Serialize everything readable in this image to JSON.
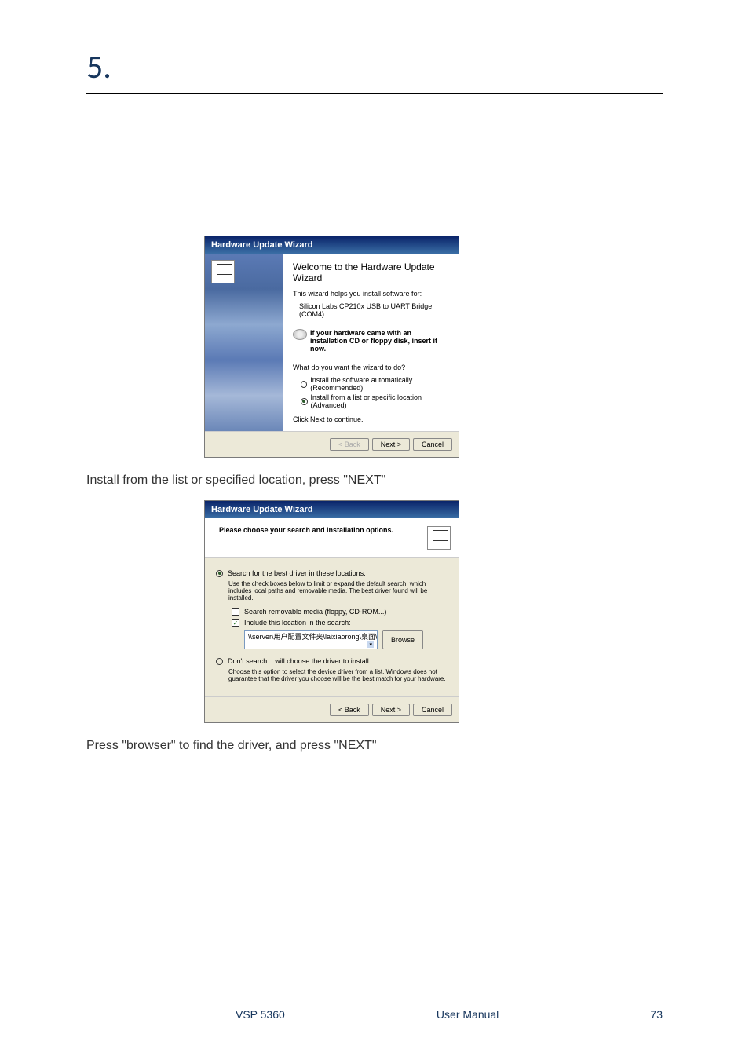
{
  "section_number": "5.",
  "wizard1": {
    "titlebar": "Hardware Update Wizard",
    "heading": "Welcome to the Hardware Update Wizard",
    "helps_line": "This wizard helps you install software for:",
    "device": "Silicon Labs CP210x USB to UART Bridge (COM4)",
    "cd_bold": "If your hardware came with an installation CD or floppy disk, insert it now.",
    "what_do": "What do you want the wizard to do?",
    "radio_auto": "Install the software automatically (Recommended)",
    "radio_list": "Install from a list or specific location (Advanced)",
    "click_next": "Click Next to continue.",
    "back": "< Back",
    "next": "Next >",
    "cancel": "Cancel"
  },
  "caption1": "Install from the list or specified location, press \"NEXT\"",
  "wizard2": {
    "titlebar": "Hardware Update Wizard",
    "header": "Please choose your search and installation options.",
    "radio_search": "Search for the best driver in these locations.",
    "search_desc": "Use the check boxes below to limit or expand the default search, which includes local paths and removable media. The best driver found will be installed.",
    "check_removable": "Search removable media (floppy, CD-ROM...)",
    "check_include": "Include this location in the search:",
    "path": "\\\\server\\用户配置文件夹\\laixiaorong\\桌面\\OLED",
    "browse": "Browse",
    "radio_dont": "Don't search. I will choose the driver to install.",
    "dont_desc": "Choose this option to select the device driver from a list.  Windows does not guarantee that the driver you choose will be the best match for your hardware.",
    "back": "< Back",
    "next": "Next >",
    "cancel": "Cancel"
  },
  "caption2": "Press \"browser\" to find the driver, and press \"NEXT\"",
  "footer": {
    "product": "VSP 5360",
    "doc": "User Manual",
    "page": "73"
  }
}
